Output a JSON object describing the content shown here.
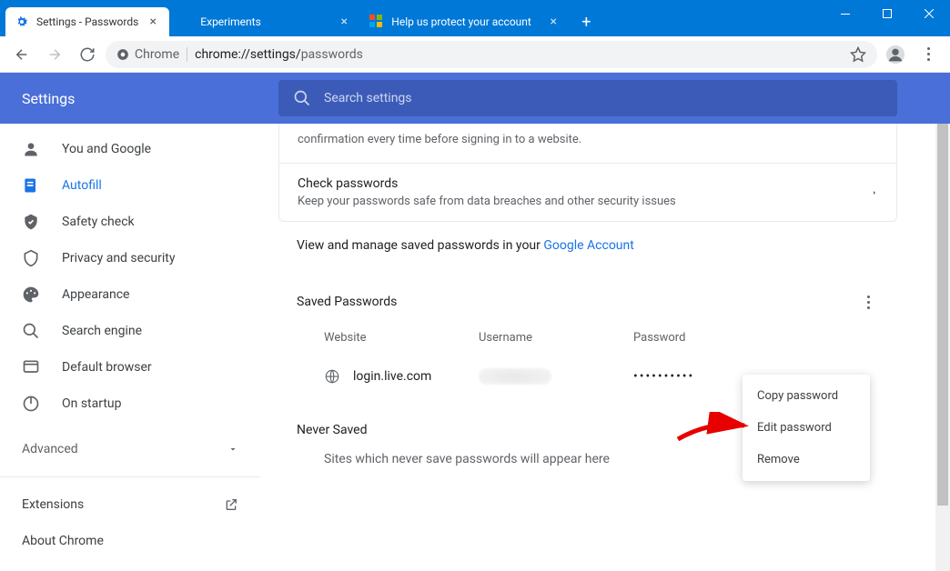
{
  "window": {
    "tabs": [
      {
        "label": "Settings - Passwords",
        "active": true
      },
      {
        "label": "Experiments",
        "active": false
      },
      {
        "label": "Help us protect your account",
        "active": false
      }
    ]
  },
  "omnibox": {
    "chip": "Chrome",
    "host": "chrome://settings/",
    "path": "passwords"
  },
  "sidebar": {
    "title": "Settings",
    "items": [
      {
        "label": "You and Google",
        "icon": "person"
      },
      {
        "label": "Autofill",
        "icon": "autofill",
        "active": true
      },
      {
        "label": "Safety check",
        "icon": "safety"
      },
      {
        "label": "Privacy and security",
        "icon": "shield"
      },
      {
        "label": "Appearance",
        "icon": "palette"
      },
      {
        "label": "Search engine",
        "icon": "search"
      },
      {
        "label": "Default browser",
        "icon": "browser"
      },
      {
        "label": "On startup",
        "icon": "power"
      }
    ],
    "advanced": "Advanced",
    "extensions": "Extensions",
    "about": "About Chrome"
  },
  "search": {
    "placeholder": "Search settings"
  },
  "main": {
    "continuation": "confirmation every time before signing in to a website.",
    "check": {
      "title": "Check passwords",
      "sub": "Keep your passwords safe from data breaches and other security issues"
    },
    "view_manage_pre": "View and manage saved passwords in your ",
    "view_manage_link": "Google Account",
    "saved_header": "Saved Passwords",
    "cols": {
      "website": "Website",
      "username": "Username",
      "password": "Password"
    },
    "rows": [
      {
        "site": "login.live.com",
        "username": "",
        "password": "••••••••••"
      }
    ],
    "never_header": "Never Saved",
    "never_text": "Sites which never save passwords will appear here"
  },
  "menu": {
    "copy": "Copy password",
    "edit": "Edit password",
    "remove": "Remove"
  }
}
